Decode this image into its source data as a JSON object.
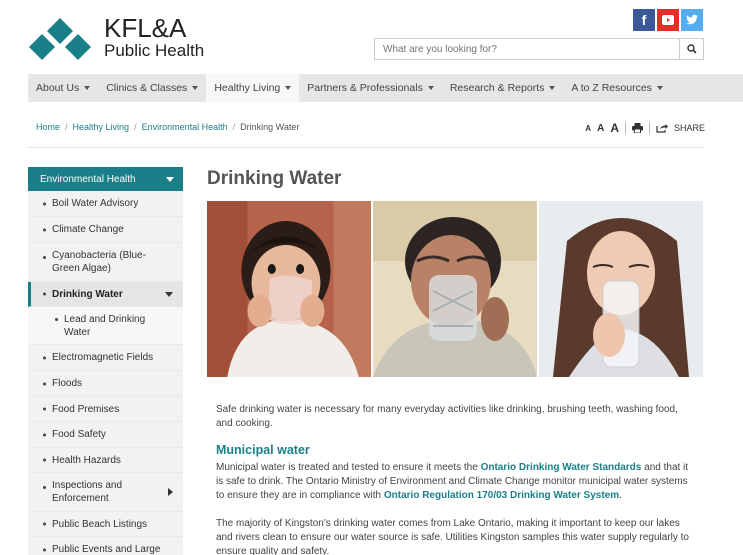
{
  "header": {
    "logo_line1": "KFL&A",
    "logo_line2": "Public Health",
    "social": [
      "facebook-icon",
      "youtube-icon",
      "twitter-icon"
    ],
    "search_placeholder": "What are you looking for?"
  },
  "nav": [
    {
      "label": "About Us"
    },
    {
      "label": "Clinics & Classes"
    },
    {
      "label": "Healthy Living"
    },
    {
      "label": "Partners & Professionals"
    },
    {
      "label": "Research & Reports"
    },
    {
      "label": "A to Z Resources"
    }
  ],
  "breadcrumb": [
    "Home",
    "Healthy Living",
    "Environmental Health",
    "Drinking Water"
  ],
  "tools": {
    "font_small": "A",
    "font_medium": "A",
    "font_large": "A",
    "share": "SHARE"
  },
  "sidebar": {
    "heading": "Environmental Health",
    "items": [
      {
        "label": "Boil Water Advisory"
      },
      {
        "label": "Climate Change"
      },
      {
        "label": "Cyanobacteria (Blue-Green Algae)"
      },
      {
        "label": "Drinking Water"
      },
      {
        "label": "Lead and Drinking Water"
      },
      {
        "label": "Electromagnetic Fields"
      },
      {
        "label": "Floods"
      },
      {
        "label": "Food Premises"
      },
      {
        "label": "Food Safety"
      },
      {
        "label": "Health Hazards"
      },
      {
        "label": "Inspections and Enforcement"
      },
      {
        "label": "Public Beach Listings"
      },
      {
        "label": "Public Events and Large"
      }
    ]
  },
  "main": {
    "title": "Drinking Water",
    "intro": "Safe drinking water is necessary for many everyday activities like drinking, brushing teeth, washing food, and cooking.",
    "section_heading": "Municipal water",
    "p1_a": "Municipal water is treated and tested to ensure it meets the ",
    "p1_link1": "Ontario Drinking Water Standards",
    "p1_b": " and that it is safe to drink. The Ontario Ministry of Environment and Climate Change monitor municipal water systems to ensure they are in compliance with ",
    "p1_link2": "Ontario Regulation 170/03 Drinking Water System",
    "p1_c": ".",
    "p2": "The majority of Kingston's drinking water comes from Lake Ontario, making it important to keep our lakes and rivers clean to ensure our water source is safe. Utilities Kingston samples this water supply regularly to ensure quality and safety."
  },
  "colors": {
    "teal": "#1a7f88",
    "nav_bg": "#e6e6e6"
  }
}
